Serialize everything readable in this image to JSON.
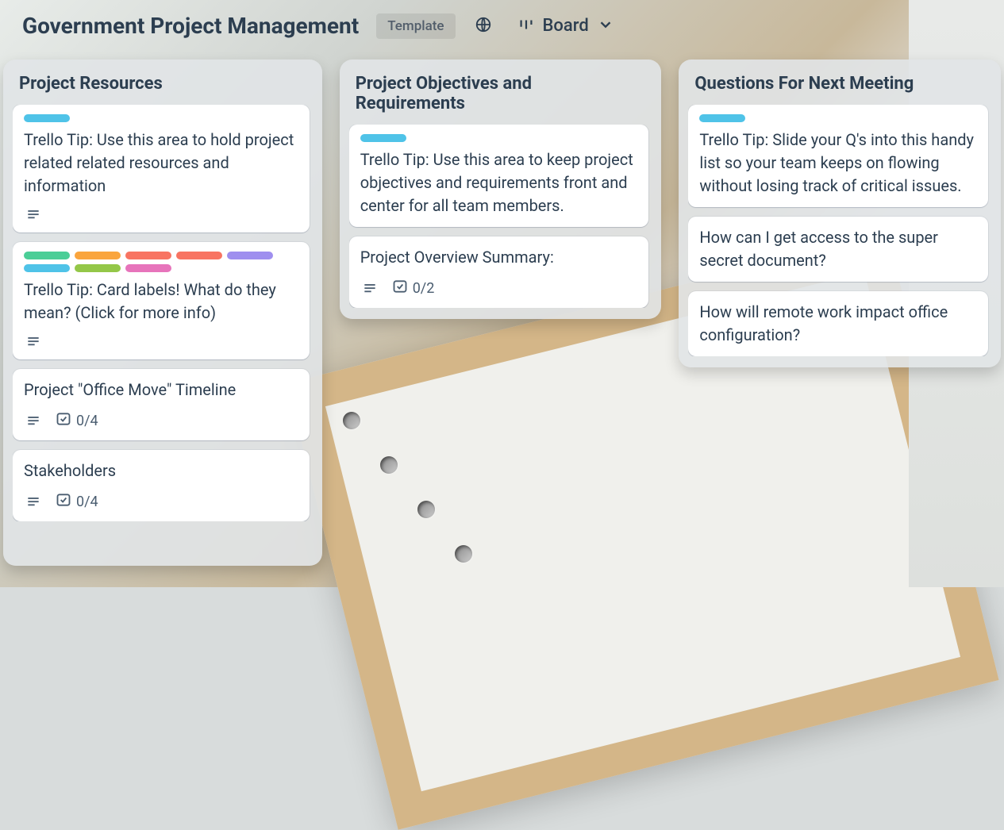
{
  "header": {
    "title": "Government Project Management",
    "template_label": "Template",
    "view_label": "Board"
  },
  "label_colors": {
    "sky": "#4fc3e8",
    "green": "#4bce97",
    "orange": "#faa53d",
    "red": "#f87462",
    "red2": "#f87462",
    "purple": "#9f8fef",
    "lime": "#94c748",
    "pink": "#e774bb"
  },
  "lists": [
    {
      "title": "Project Resources",
      "cards": [
        {
          "labels": [
            "sky"
          ],
          "text": "Trello Tip: Use this area to hold project related related resources and information",
          "has_description": true
        },
        {
          "labels": [
            "green",
            "orange",
            "red",
            "red2",
            "purple",
            "sky",
            "lime",
            "pink"
          ],
          "text": "Trello Tip: Card labels! What do they mean? (Click for more info)",
          "has_description": true
        },
        {
          "labels": [],
          "text": "Project \"Office Move\" Timeline",
          "has_description": true,
          "checklist": "0/4"
        },
        {
          "labels": [],
          "text": "Stakeholders",
          "has_description": true,
          "checklist": "0/4"
        }
      ]
    },
    {
      "title": "Project Objectives and Requirements",
      "cards": [
        {
          "labels": [
            "sky"
          ],
          "text": "Trello Tip: Use this area to keep project objectives and requirements front and center for all team members."
        },
        {
          "labels": [],
          "text": "Project Overview Summary:",
          "has_description": true,
          "checklist": "0/2"
        }
      ]
    },
    {
      "title": "Questions For Next Meeting",
      "cards": [
        {
          "labels": [
            "sky"
          ],
          "text": "Trello Tip: Slide your Q's into this handy list so your team keeps on flowing without losing track of critical issues."
        },
        {
          "labels": [],
          "text": "How can I get access to the super secret document?"
        },
        {
          "labels": [],
          "text": "How will remote work impact office configuration?"
        }
      ]
    }
  ]
}
